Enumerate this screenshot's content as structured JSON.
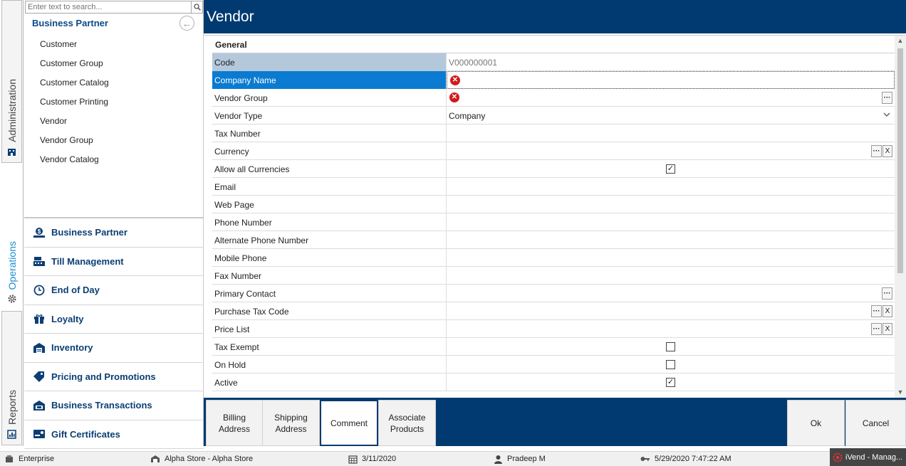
{
  "vtabs": {
    "administration": "Administration",
    "operations": "Operations",
    "reports": "Reports"
  },
  "sidebar": {
    "search_placeholder": "Enter text to search...",
    "header": "Business Partner",
    "sub_items": [
      "Customer",
      "Customer Group",
      "Customer Catalog",
      "Customer Printing",
      "Vendor",
      "Vendor Group",
      "Vendor Catalog"
    ],
    "modules": [
      "Business Partner",
      "Till Management",
      "End of Day",
      "Loyalty",
      "Inventory",
      "Pricing and Promotions",
      "Business Transactions",
      "Gift Certificates"
    ]
  },
  "window": {
    "title": "Vendor"
  },
  "form": {
    "section": "General",
    "rows": [
      {
        "label": "Code",
        "value": "V000000001"
      },
      {
        "label": "Company Name",
        "value": ""
      },
      {
        "label": "Vendor Group",
        "value": ""
      },
      {
        "label": "Vendor Type",
        "value": "Company"
      },
      {
        "label": "Tax Number",
        "value": ""
      },
      {
        "label": "Currency",
        "value": ""
      },
      {
        "label": "Allow all Currencies",
        "checked": true
      },
      {
        "label": "Email",
        "value": ""
      },
      {
        "label": "Web Page",
        "value": ""
      },
      {
        "label": "Phone Number",
        "value": ""
      },
      {
        "label": "Alternate Phone Number",
        "value": ""
      },
      {
        "label": "Mobile Phone",
        "value": ""
      },
      {
        "label": "Fax Number",
        "value": ""
      },
      {
        "label": "Primary Contact",
        "value": ""
      },
      {
        "label": "Purchase Tax Code",
        "value": ""
      },
      {
        "label": "Price List",
        "value": ""
      },
      {
        "label": "Tax Exempt",
        "checked": false
      },
      {
        "label": "On Hold",
        "checked": false
      },
      {
        "label": "Active",
        "checked": true
      }
    ],
    "ellipsis": "···",
    "clear": "X",
    "check_mark": "✓",
    "error_mark": "✕",
    "dropdown_icon": "chevron-down-icon"
  },
  "actions": {
    "billing": "Billing\nAddress",
    "shipping": "Shipping\nAddress",
    "comment": "Comment",
    "associate": "Associate\nProducts",
    "ok": "Ok",
    "cancel": "Cancel"
  },
  "status": {
    "edition": "Enterprise",
    "store": "Alpha Store - Alpha Store",
    "date": "3/11/2020",
    "user": "Pradeep M",
    "login_time": "5/29/2020 7:47:22 AM",
    "app": "iVend - Manag..."
  },
  "colors": {
    "accent": "#003a70",
    "selected": "#0a7bd1",
    "error": "#d21a1a",
    "code_row": "#b4c8dc"
  }
}
